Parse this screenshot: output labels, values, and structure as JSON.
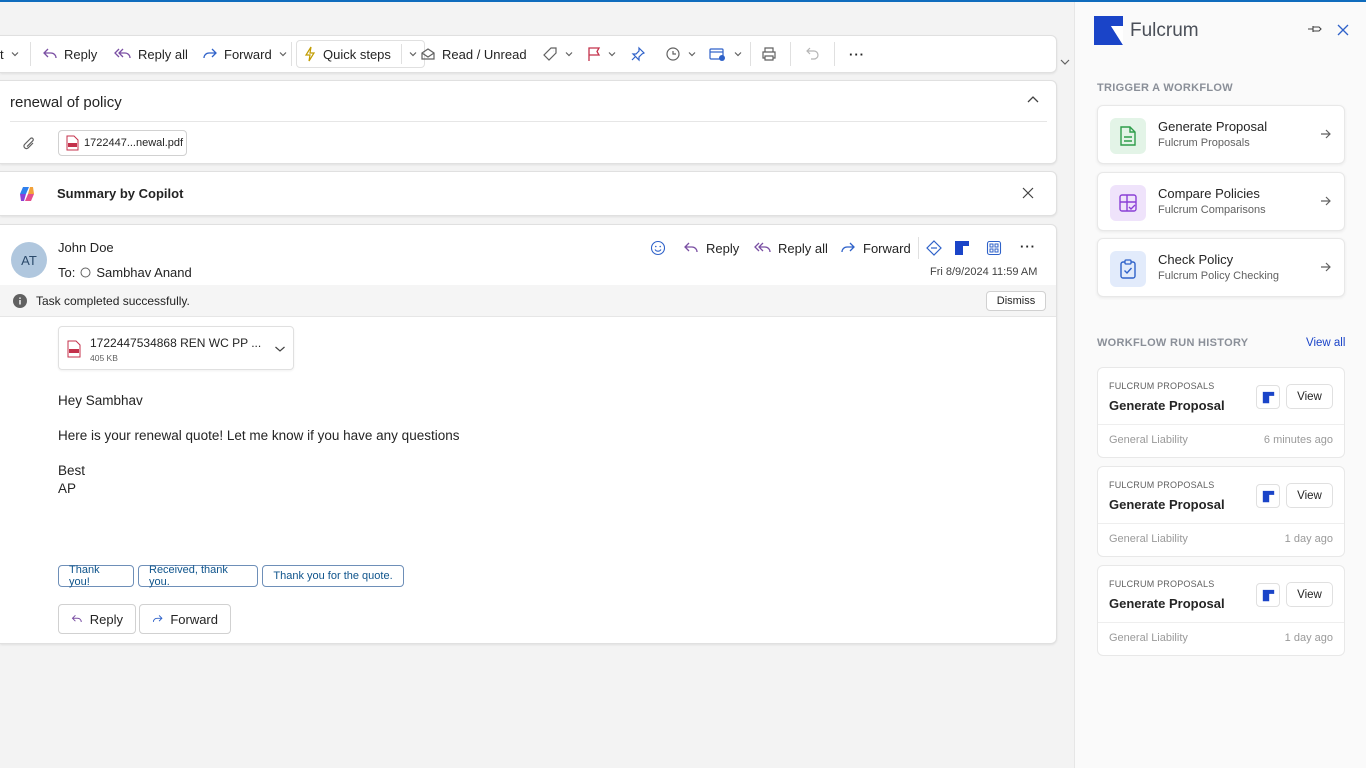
{
  "toolbar": {
    "partial_label": "t",
    "reply": "Reply",
    "reply_all": "Reply all",
    "forward": "Forward",
    "quick_steps": "Quick steps",
    "read_unread": "Read / Unread",
    "more": "···"
  },
  "message": {
    "subject": "renewal of policy",
    "attachment_chip": "1722447...newal.pdf",
    "copilot_label": "Summary by Copilot",
    "sender": "John Doe",
    "avatar_initials": "AT",
    "to_prefix": "To:",
    "recipient": "Sambhav Anand",
    "date": "Fri 8/9/2024 11:59 AM",
    "actions": {
      "reply": "Reply",
      "reply_all": "Reply all",
      "forward": "Forward",
      "more": "···"
    },
    "banner_text": "Task completed successfully.",
    "dismiss_label": "Dismiss",
    "attachment_name": "1722447534868 REN WC PP ...",
    "attachment_size": "405 KB",
    "body": {
      "greeting": "Hey Sambhav",
      "line1": "Here is your renewal quote! Let me know if you have any questions",
      "signoff1": "Best",
      "signoff2": "AP"
    },
    "quick_replies": [
      "Thank you!",
      "Received, thank you.",
      "Thank you for the quote."
    ],
    "bottom_reply": "Reply",
    "bottom_forward": "Forward"
  },
  "panel": {
    "brand": "Fulcrum",
    "trigger_title": "TRIGGER A WORKFLOW",
    "workflows": [
      {
        "title": "Generate Proposal",
        "subtitle": "Fulcrum Proposals",
        "icon": "document-icon",
        "color": "#2e9d4a",
        "bg": "#e3f4e7"
      },
      {
        "title": "Compare Policies",
        "subtitle": "Fulcrum Comparisons",
        "icon": "grid-compare-icon",
        "color": "#8a3fd6",
        "bg": "#efe3fb"
      },
      {
        "title": "Check Policy",
        "subtitle": "Fulcrum Policy Checking",
        "icon": "clipboard-check-icon",
        "color": "#2f62c9",
        "bg": "#e2ebfb"
      }
    ],
    "history_title": "WORKFLOW RUN HISTORY",
    "view_all": "View all",
    "runs": [
      {
        "category": "FULCRUM PROPOSALS",
        "title": "Generate Proposal",
        "view": "View",
        "type": "General Liability",
        "time": "6 minutes ago"
      },
      {
        "category": "FULCRUM PROPOSALS",
        "title": "Generate Proposal",
        "view": "View",
        "type": "General Liability",
        "time": "1 day ago"
      },
      {
        "category": "FULCRUM PROPOSALS",
        "title": "Generate Proposal",
        "view": "View",
        "type": "General Liability",
        "time": "1 day ago"
      }
    ]
  },
  "colors": {
    "accent": "#0f6cbd",
    "brand": "#1a44c8",
    "reply_icon": "#7a4fa3"
  }
}
